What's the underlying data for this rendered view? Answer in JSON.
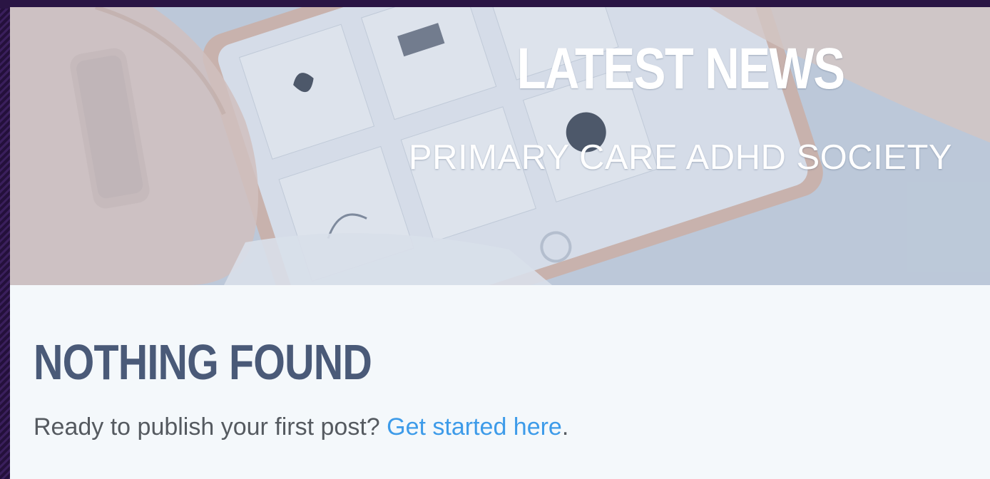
{
  "hero": {
    "title": "LATEST NEWS",
    "subtitle": "PRIMARY CARE ADHD SOCIETY",
    "background_image": "hands-holding-tablet-image"
  },
  "content": {
    "title": "NOTHING FOUND",
    "message": "Ready to publish your first post?",
    "link_label": "Get started here",
    "trailing": "."
  },
  "colors": {
    "frame": "#2b1545",
    "heading": "#4a5a78",
    "link": "#3d9be9",
    "panel": "#f4f8fb"
  }
}
